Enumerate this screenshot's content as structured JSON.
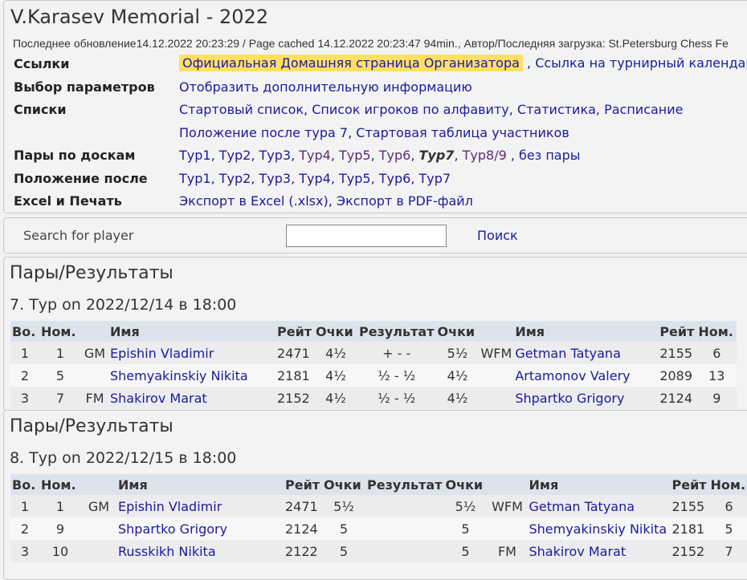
{
  "header": {
    "title": "V.Karasev Memorial - 2022",
    "updated": "Последнее обновление14.12.2022 20:23:29 / Page cached 14.12.2022 20:23:47 94min., Автор/Последняя загрузка: St.Petersburg Chess Fe"
  },
  "links": {
    "label": "Ссылки",
    "official_home": "Официальная Домашняя страница Организатора",
    "calendar": "Ссылка на турнирный календар"
  },
  "params": {
    "label": "Выбор параметров",
    "show_more": "Отобразить дополнительную информацию"
  },
  "lists": {
    "label": "Списки",
    "start_list": "Стартовый список",
    "alpha_list": "Список игроков по алфавиту",
    "stats": "Статистика",
    "schedule": "Расписание",
    "standing_after": "Положение после тура 7",
    "start_table": "Стартовая таблица участников"
  },
  "pairings": {
    "label": "Пары по доскам",
    "rounds": [
      "Тур1",
      "Тур2",
      "Тур3",
      "Тур4",
      "Тур5",
      "Тур6",
      "Тур7",
      "Тур8/9",
      "без пары"
    ]
  },
  "standings": {
    "label": "Положение после",
    "rounds": [
      "Тур1",
      "Тур2",
      "Тур3",
      "Тур4",
      "Тур5",
      "Тур6",
      "Тур7"
    ]
  },
  "export": {
    "label": "Excel и Печать",
    "excel": "Экспорт в Excel (.xlsx)",
    "pdf": "Экспорт в PDF-файл"
  },
  "search": {
    "label": "Search for player",
    "button": "Поиск",
    "value": ""
  },
  "columns": [
    "Во.",
    "Ном.",
    "",
    "Имя",
    "Рейт",
    "Очки",
    "Результат",
    "Очки",
    "",
    "Имя",
    "Рейт",
    "Ном."
  ],
  "round7": {
    "heading": "Пары/Результаты",
    "subheading": "7. Тур on 2022/12/14 в 18:00",
    "rows": [
      {
        "board": "1",
        "no1": "1",
        "title1": "GM",
        "name1": "Epishin Vladimir",
        "rtg1": "2471",
        "pts1": "4½",
        "result": "+ - -",
        "pts2": "5½",
        "title2": "WFM",
        "name2": "Getman Tatyana",
        "rtg2": "2155",
        "no2": "6"
      },
      {
        "board": "2",
        "no1": "5",
        "title1": "",
        "name1": "Shemyakinskiy Nikita",
        "rtg1": "2181",
        "pts1": "4½",
        "result": "½ - ½",
        "pts2": "4½",
        "title2": "",
        "name2": "Artamonov Valery",
        "rtg2": "2089",
        "no2": "13"
      },
      {
        "board": "3",
        "no1": "7",
        "title1": "FM",
        "name1": "Shakirov Marat",
        "rtg1": "2152",
        "pts1": "4½",
        "result": "½ - ½",
        "pts2": "4½",
        "title2": "",
        "name2": "Shpartko Grigory",
        "rtg2": "2124",
        "no2": "9"
      }
    ]
  },
  "round8": {
    "heading": "Пары/Результаты",
    "subheading": "8. Тур on 2022/12/15 в 18:00",
    "rows": [
      {
        "board": "1",
        "no1": "1",
        "title1": "GM",
        "name1": "Epishin Vladimir",
        "rtg1": "2471",
        "pts1": "5½",
        "result": "",
        "pts2": "5½",
        "title2": "WFM",
        "name2": "Getman Tatyana",
        "rtg2": "2155",
        "no2": "6"
      },
      {
        "board": "2",
        "no1": "9",
        "title1": "",
        "name1": "Shpartko Grigory",
        "rtg1": "2124",
        "pts1": "5",
        "result": "",
        "pts2": "5",
        "title2": "",
        "name2": "Shemyakinskiy Nikita",
        "rtg2": "2181",
        "no2": "5"
      },
      {
        "board": "3",
        "no1": "10",
        "title1": "",
        "name1": "Russkikh Nikita",
        "rtg1": "2122",
        "pts1": "5",
        "result": "",
        "pts2": "5",
        "title2": "FM",
        "name2": "Shakirov Marat",
        "rtg2": "2152",
        "no2": "7"
      }
    ]
  }
}
